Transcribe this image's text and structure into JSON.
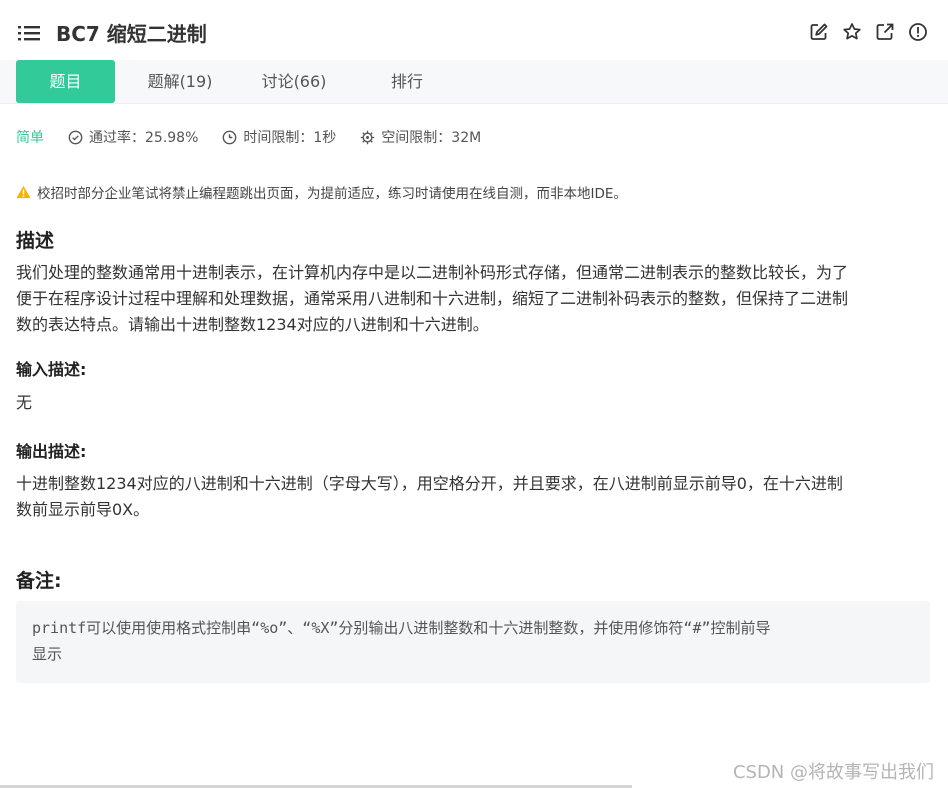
{
  "header": {
    "title": "BC7  缩短二进制",
    "icons": [
      "edit-icon",
      "star-icon",
      "external-link-icon",
      "info-icon"
    ]
  },
  "tabs": [
    {
      "label": "题目",
      "active": true
    },
    {
      "label": "题解(19)",
      "active": false
    },
    {
      "label": "讨论(66)",
      "active": false
    },
    {
      "label": "排行",
      "active": false
    }
  ],
  "meta": {
    "level": "简单",
    "pass_rate": "通过率：25.98%",
    "time_limit": "时间限制：1秒",
    "space_limit": "空间限制：32M"
  },
  "notice": "校招时部分企业笔试将禁止编程题跳出页面，为提前适应，练习时请使用在线自测，而非本地IDE。",
  "description": {
    "heading": "描述",
    "line1": "我们处理的整数通常用十进制表示，在计算机内存中是以二进制补码形式存储，但通常二进制表示的整数比较长，为了",
    "line2": "便于在程序设计过程中理解和处理数据，通常采用八进制和十六进制，缩短了二进制补码表示的整数，但保持了二进制",
    "line3": "数的表达特点。请输出十进制整数1234对应的八进制和十六进制。"
  },
  "input": {
    "heading": "输入描述:",
    "text": "无"
  },
  "output": {
    "heading": "输出描述:",
    "line1": "十进制整数1234对应的八进制和十六进制（字母大写），用空格分开，并且要求，在八进制前显示前导0，在十六进制",
    "line2": "数前显示前导0X。"
  },
  "note": {
    "heading": "备注:",
    "line1": "printf可以使用使用格式控制串“%o”、“%X”分别输出八进制整数和十六进制整数，并使用修饰符“#”控制前导",
    "line2": "显示"
  },
  "watermark": "CSDN @将故事写出我们",
  "colors": {
    "accent": "#32ca99",
    "tabbar_bg": "#f7f8fa",
    "codebox_bg": "#f5f6f8",
    "warning": "#f5b400"
  }
}
